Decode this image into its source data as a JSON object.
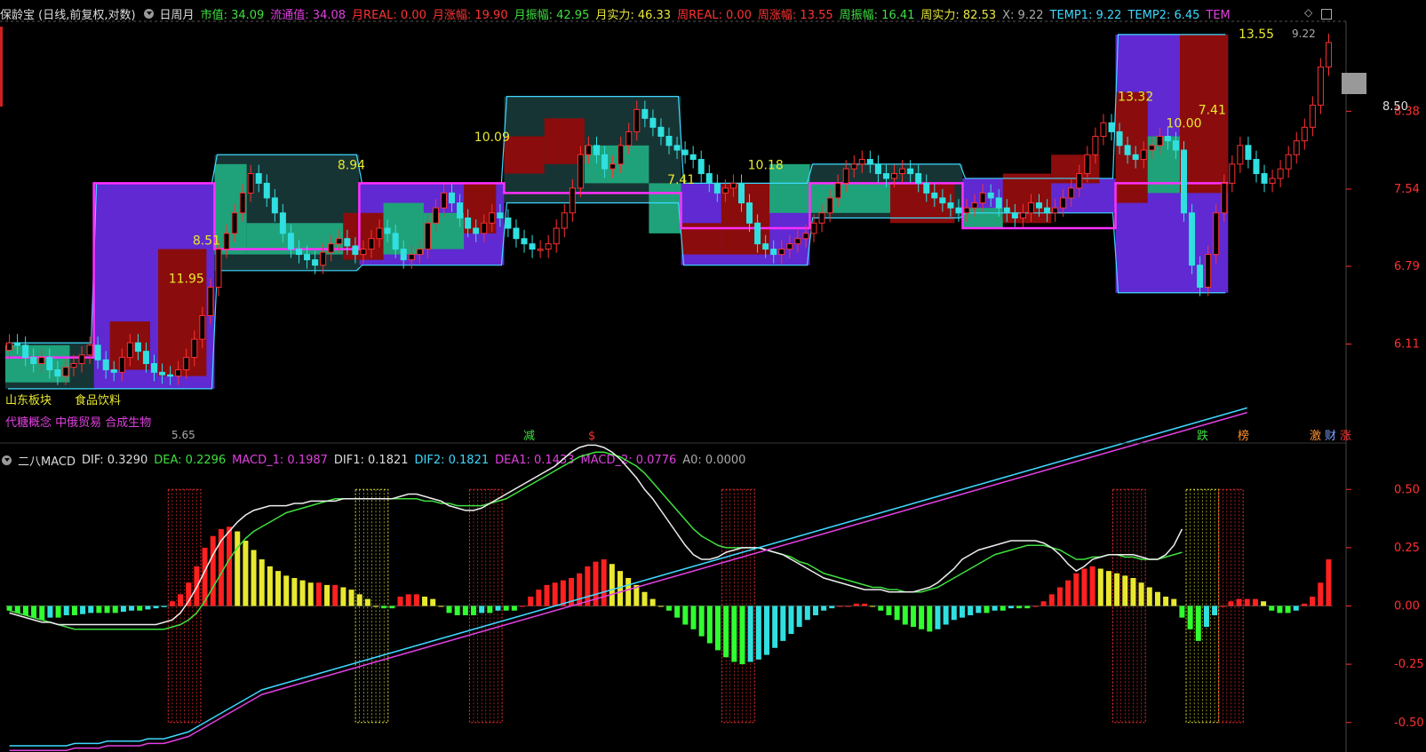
{
  "main_header": {
    "title": "保龄宝 (日线,前复权,对数)",
    "period": "日周月",
    "fields": [
      {
        "text": "市值: 34.09",
        "color": "#3fe03f"
      },
      {
        "text": "流通值: 34.08",
        "color": "#e040e0"
      },
      {
        "text": "月REAL: 0.00",
        "color": "#ff3333"
      },
      {
        "text": "月涨幅: 19.90",
        "color": "#ff3333"
      },
      {
        "text": "月振幅: 42.95",
        "color": "#3fe03f"
      },
      {
        "text": "月实力: 46.33",
        "color": "#e8e83c"
      },
      {
        "text": "周REAL: 0.00",
        "color": "#ff3333"
      },
      {
        "text": "周涨幅: 13.55",
        "color": "#ff3333"
      },
      {
        "text": "周振幅: 16.41",
        "color": "#3fe03f"
      },
      {
        "text": "周实力: 82.53",
        "color": "#e8e83c"
      },
      {
        "text": "X: 9.22",
        "color": "#aaaaaa"
      },
      {
        "text": "TEMP1: 9.22",
        "color": "#3fd8ff"
      },
      {
        "text": "TEMP2: 6.45",
        "color": "#3fd8ff"
      },
      {
        "text": "TEM",
        "color": "#e040e0"
      }
    ]
  },
  "macd_header": {
    "title": "二八MACD",
    "fields": [
      {
        "text": "DIF: 0.3290",
        "color": "#dddddd"
      },
      {
        "text": "DEA: 0.2296",
        "color": "#3fe03f"
      },
      {
        "text": "MACD_1: 0.1987",
        "color": "#e040e0"
      },
      {
        "text": "DIF1: 0.1821",
        "color": "#dddddd"
      },
      {
        "text": "DIF2: 0.1821",
        "color": "#3fd8ff"
      },
      {
        "text": "DEA1: 0.1433",
        "color": "#e040e0"
      },
      {
        "text": "MACD_2: 0.0776",
        "color": "#e040e0"
      },
      {
        "text": "A0: 0.0000",
        "color": "#aaaaaa"
      }
    ]
  },
  "price_axis": {
    "ticks": [
      "8.38",
      "7.54",
      "6.79",
      "6.11"
    ],
    "current_tag": "8.50",
    "top_label": "9.22",
    "low_label": "5.65"
  },
  "macd_axis": {
    "ticks": [
      "0.50",
      "0.25",
      "0.00",
      "-0.25",
      "-0.50"
    ]
  },
  "price_annotations": [
    "11.95",
    "8.51",
    "8.94",
    "10.09",
    "7.41",
    "10.18",
    "13.32",
    "10.00",
    "7.41",
    "13.55"
  ],
  "sector_tags": {
    "row1": [
      "山东板块",
      "食品饮料"
    ],
    "row2": [
      "代糖概念",
      "中俄贸易",
      "合成生物"
    ]
  },
  "markers": {
    "jian": "减",
    "dollar": "$",
    "die": "跌",
    "bang": "榜",
    "ji": "激",
    "cai": "财",
    "zhang": "涨"
  },
  "colors": {
    "up": "#ff3030",
    "down": "#30e0e0",
    "purple_box": "#6a2ee8",
    "teal_box": "#1fa27a",
    "dark_box": "#8b0c0c",
    "zone": "#1a3a3a",
    "magenta_line": "#ff30ff",
    "cyan_line": "#3fd8ff"
  },
  "chart_data": [
    {
      "type": "candlestick",
      "title": "保龄宝 (日线,前复权,对数)",
      "y_scale": "log",
      "y_ticks": [
        8.38,
        7.54,
        6.79,
        6.11
      ],
      "ylim": [
        5.4,
        9.4
      ],
      "close": [
        6.12,
        6.1,
        6.0,
        5.95,
        6.0,
        5.9,
        5.85,
        5.92,
        5.95,
        6.02,
        6.1,
        5.98,
        5.9,
        5.88,
        6.0,
        6.12,
        6.05,
        5.95,
        5.88,
        5.86,
        5.85,
        5.9,
        6.0,
        6.15,
        6.35,
        6.6,
        6.95,
        7.1,
        7.3,
        7.5,
        7.7,
        7.6,
        7.45,
        7.3,
        7.1,
        6.95,
        6.9,
        6.85,
        6.8,
        6.92,
        7.0,
        7.05,
        6.98,
        6.9,
        6.95,
        7.05,
        7.15,
        7.1,
        6.95,
        6.85,
        6.9,
        6.95,
        7.2,
        7.35,
        7.5,
        7.4,
        7.25,
        7.15,
        7.1,
        7.2,
        7.3,
        7.25,
        7.15,
        7.05,
        7.0,
        6.95,
        6.95,
        7.0,
        7.15,
        7.3,
        7.55,
        7.9,
        8.0,
        7.9,
        7.75,
        7.8,
        8.0,
        8.15,
        8.4,
        8.3,
        8.2,
        8.1,
        8.0,
        7.95,
        7.9,
        7.85,
        7.7,
        7.6,
        7.5,
        7.55,
        7.6,
        7.4,
        7.2,
        7.0,
        6.95,
        6.9,
        6.95,
        7.0,
        7.05,
        7.1,
        7.2,
        7.3,
        7.45,
        7.6,
        7.75,
        7.8,
        7.85,
        7.8,
        7.7,
        7.65,
        7.7,
        7.75,
        7.7,
        7.6,
        7.5,
        7.45,
        7.4,
        7.35,
        7.3,
        7.35,
        7.4,
        7.5,
        7.45,
        7.35,
        7.3,
        7.25,
        7.3,
        7.4,
        7.35,
        7.3,
        7.35,
        7.45,
        7.55,
        7.7,
        7.9,
        8.1,
        8.25,
        8.15,
        8.0,
        7.9,
        7.85,
        7.95,
        8.0,
        8.1,
        8.05,
        7.95,
        7.3,
        6.8,
        6.6,
        6.9,
        7.3,
        7.6,
        7.8,
        8.0,
        7.85,
        7.7,
        7.6,
        7.65,
        7.75,
        7.9,
        8.05,
        8.2,
        8.45,
        8.9,
        9.2
      ],
      "price_labels": [
        11.95,
        8.51,
        8.94,
        10.09,
        7.41,
        10.18,
        13.32,
        10.0,
        7.41,
        13.55
      ]
    },
    {
      "type": "bar+line",
      "title": "二八MACD",
      "ylim": [
        -0.6,
        0.6
      ],
      "y_ticks": [
        0.5,
        0.25,
        0.0,
        -0.25,
        -0.5
      ],
      "macd_bars": [
        -0.02,
        -0.03,
        -0.04,
        -0.05,
        -0.06,
        -0.05,
        -0.05,
        -0.04,
        -0.04,
        -0.035,
        -0.03,
        -0.03,
        -0.03,
        -0.03,
        -0.025,
        -0.02,
        -0.02,
        -0.015,
        -0.01,
        -0.005,
        0.02,
        0.05,
        0.1,
        0.17,
        0.25,
        0.3,
        0.33,
        0.34,
        0.32,
        0.28,
        0.24,
        0.2,
        0.17,
        0.15,
        0.13,
        0.12,
        0.11,
        0.1,
        0.1,
        0.09,
        0.09,
        0.08,
        0.07,
        0.05,
        0.03,
        0.0,
        -0.01,
        -0.01,
        0.04,
        0.05,
        0.05,
        0.04,
        0.03,
        0.0,
        -0.03,
        -0.04,
        -0.04,
        -0.04,
        -0.03,
        -0.03,
        -0.02,
        -0.02,
        -0.02,
        0.0,
        0.04,
        0.07,
        0.09,
        0.1,
        0.11,
        0.12,
        0.14,
        0.17,
        0.19,
        0.2,
        0.18,
        0.15,
        0.12,
        0.09,
        0.06,
        0.03,
        0.0,
        -0.02,
        -0.05,
        -0.08,
        -0.1,
        -0.13,
        -0.16,
        -0.19,
        -0.22,
        -0.24,
        -0.25,
        -0.24,
        -0.23,
        -0.21,
        -0.18,
        -0.15,
        -0.12,
        -0.09,
        -0.06,
        -0.04,
        -0.02,
        -0.01,
        0.0,
        0.0,
        0.01,
        0.01,
        0.0,
        -0.02,
        -0.04,
        -0.06,
        -0.08,
        -0.09,
        -0.1,
        -0.11,
        -0.1,
        -0.08,
        -0.06,
        -0.05,
        -0.04,
        -0.03,
        -0.03,
        -0.02,
        -0.02,
        -0.01,
        -0.01,
        -0.01,
        0.0,
        0.02,
        0.05,
        0.08,
        0.11,
        0.14,
        0.16,
        0.17,
        0.16,
        0.15,
        0.14,
        0.13,
        0.12,
        0.1,
        0.08,
        0.06,
        0.04,
        0.03,
        -0.05,
        -0.1,
        -0.15,
        -0.09,
        -0.04,
        0.0,
        0.02,
        0.03,
        0.03,
        0.03,
        0.02,
        -0.02,
        -0.03,
        -0.03,
        -0.02,
        0.01,
        0.04,
        0.1,
        0.2
      ],
      "dif_line": [
        -0.03,
        -0.04,
        -0.05,
        -0.06,
        -0.07,
        -0.07,
        -0.08,
        -0.08,
        -0.08,
        -0.08,
        -0.08,
        -0.08,
        -0.08,
        -0.08,
        -0.08,
        -0.08,
        -0.08,
        -0.08,
        -0.08,
        -0.07,
        -0.06,
        -0.03,
        0.02,
        0.08,
        0.15,
        0.22,
        0.28,
        0.32,
        0.36,
        0.39,
        0.41,
        0.42,
        0.43,
        0.43,
        0.43,
        0.44,
        0.44,
        0.45,
        0.45,
        0.45,
        0.45,
        0.46,
        0.46,
        0.46,
        0.46,
        0.46,
        0.46,
        0.46,
        0.47,
        0.48,
        0.48,
        0.47,
        0.46,
        0.45,
        0.43,
        0.42,
        0.41,
        0.41,
        0.42,
        0.44,
        0.46,
        0.48,
        0.5,
        0.52,
        0.54,
        0.56,
        0.58,
        0.6,
        0.63,
        0.66,
        0.68,
        0.69,
        0.69,
        0.68,
        0.66,
        0.63,
        0.59,
        0.55,
        0.5,
        0.46,
        0.41,
        0.36,
        0.31,
        0.26,
        0.22,
        0.2,
        0.2,
        0.21,
        0.23,
        0.24,
        0.25,
        0.25,
        0.25,
        0.24,
        0.23,
        0.22,
        0.2,
        0.18,
        0.16,
        0.14,
        0.12,
        0.11,
        0.1,
        0.09,
        0.08,
        0.07,
        0.07,
        0.07,
        0.06,
        0.06,
        0.06,
        0.06,
        0.07,
        0.08,
        0.1,
        0.13,
        0.16,
        0.2,
        0.22,
        0.24,
        0.25,
        0.26,
        0.27,
        0.28,
        0.28,
        0.28,
        0.28,
        0.27,
        0.25,
        0.22,
        0.18,
        0.15,
        0.17,
        0.2,
        0.21,
        0.22,
        0.22,
        0.22,
        0.22,
        0.21,
        0.2,
        0.2,
        0.22,
        0.26,
        0.33
      ],
      "dea_line": [
        -0.02,
        -0.03,
        -0.04,
        -0.05,
        -0.06,
        -0.07,
        -0.08,
        -0.09,
        -0.1,
        -0.1,
        -0.1,
        -0.1,
        -0.1,
        -0.1,
        -0.1,
        -0.1,
        -0.1,
        -0.1,
        -0.1,
        -0.1,
        -0.09,
        -0.08,
        -0.06,
        -0.03,
        0.02,
        0.08,
        0.14,
        0.2,
        0.25,
        0.29,
        0.32,
        0.34,
        0.36,
        0.38,
        0.4,
        0.41,
        0.42,
        0.43,
        0.44,
        0.45,
        0.46,
        0.46,
        0.46,
        0.46,
        0.46,
        0.46,
        0.46,
        0.46,
        0.46,
        0.46,
        0.46,
        0.45,
        0.45,
        0.44,
        0.44,
        0.43,
        0.43,
        0.43,
        0.43,
        0.44,
        0.45,
        0.46,
        0.48,
        0.5,
        0.52,
        0.54,
        0.56,
        0.58,
        0.6,
        0.62,
        0.64,
        0.65,
        0.66,
        0.66,
        0.65,
        0.64,
        0.62,
        0.6,
        0.57,
        0.53,
        0.49,
        0.45,
        0.41,
        0.37,
        0.33,
        0.3,
        0.28,
        0.26,
        0.25,
        0.25,
        0.25,
        0.25,
        0.25,
        0.24,
        0.23,
        0.22,
        0.21,
        0.19,
        0.18,
        0.16,
        0.14,
        0.13,
        0.12,
        0.11,
        0.1,
        0.09,
        0.08,
        0.08,
        0.07,
        0.07,
        0.06,
        0.06,
        0.06,
        0.07,
        0.08,
        0.1,
        0.12,
        0.14,
        0.16,
        0.18,
        0.2,
        0.22,
        0.23,
        0.24,
        0.25,
        0.26,
        0.26,
        0.26,
        0.25,
        0.24,
        0.22,
        0.2,
        0.2,
        0.21,
        0.21,
        0.22,
        0.22,
        0.21,
        0.21,
        0.2,
        0.2,
        0.2,
        0.21,
        0.22,
        0.23
      ],
      "dif2_line": [
        -0.6,
        -0.6,
        -0.6,
        -0.6,
        -0.6,
        -0.6,
        -0.6,
        -0.6,
        -0.59,
        -0.59,
        -0.59,
        -0.59,
        -0.58,
        -0.58,
        -0.58,
        -0.58,
        -0.58,
        -0.57,
        -0.57,
        -0.57,
        -0.56,
        -0.55,
        -0.54,
        -0.52,
        -0.5,
        -0.48,
        -0.46,
        -0.44,
        -0.42,
        -0.4,
        -0.38,
        -0.36,
        -0.35,
        -0.34,
        -0.33,
        -0.32,
        -0.31,
        -0.3,
        -0.29,
        -0.28,
        -0.27,
        -0.26,
        -0.25,
        -0.24,
        -0.23,
        -0.22,
        -0.21,
        -0.2,
        -0.19,
        -0.18,
        -0.17,
        -0.16,
        -0.15,
        -0.14,
        -0.13,
        -0.12,
        -0.11,
        -0.1,
        -0.09,
        -0.08,
        -0.07,
        -0.06,
        -0.05,
        -0.04,
        -0.03,
        -0.02,
        -0.01,
        0.0,
        0.01,
        0.02,
        0.03,
        0.04,
        0.05,
        0.06,
        0.07,
        0.08,
        0.09,
        0.1,
        0.11,
        0.12,
        0.13,
        0.14,
        0.15,
        0.16,
        0.17,
        0.18,
        0.19,
        0.2,
        0.21,
        0.22,
        0.23,
        0.24,
        0.25,
        0.26,
        0.27,
        0.28,
        0.29,
        0.3,
        0.31,
        0.32,
        0.33,
        0.34,
        0.35,
        0.36,
        0.37,
        0.38,
        0.39,
        0.4,
        0.41,
        0.42,
        0.43,
        0.44,
        0.45,
        0.46,
        0.47,
        0.48,
        0.49,
        0.5,
        0.51,
        0.52,
        0.53,
        0.54,
        0.55,
        0.56,
        0.57,
        0.58,
        0.59,
        0.6,
        0.61,
        0.62,
        0.63,
        0.64,
        0.65,
        0.66,
        0.67,
        0.68,
        0.69,
        0.7,
        0.71,
        0.72,
        0.73,
        0.74,
        0.75,
        0.76,
        0.77,
        0.78,
        0.79,
        0.8,
        0.81,
        0.82,
        0.83,
        0.84,
        0.85
      ],
      "signal_zones": [
        {
          "from": 20,
          "to": 24,
          "color": "#ff3030"
        },
        {
          "from": 43,
          "to": 47,
          "color": "#e8e830"
        },
        {
          "from": 57,
          "to": 61,
          "color": "#ff3030"
        },
        {
          "from": 88,
          "to": 92,
          "color": "#ff3030"
        },
        {
          "from": 136,
          "to": 140,
          "color": "#ff3030"
        },
        {
          "from": 145,
          "to": 149,
          "color": "#e8e830"
        },
        {
          "from": 149,
          "to": 152,
          "color": "#ff3030"
        }
      ]
    }
  ]
}
